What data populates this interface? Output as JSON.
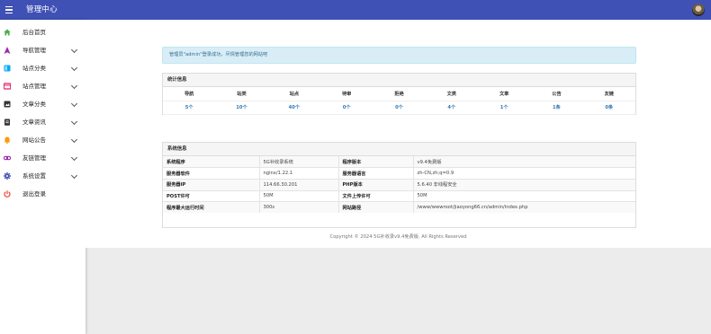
{
  "header": {
    "title": "管理中心",
    "menu_icon": "hamburger-menu-icon",
    "avatar_icon": "user-avatar-icon"
  },
  "sidebar": {
    "items": [
      {
        "label": "后台首页",
        "icon": "home-icon",
        "color": "#4caf50",
        "has_submenu": false
      },
      {
        "label": "导航管理",
        "icon": "navigation-icon",
        "color": "#9c27b0",
        "has_submenu": true
      },
      {
        "label": "站点分类",
        "icon": "category-icon",
        "color": "#03a9f4",
        "has_submenu": true
      },
      {
        "label": "站点管理",
        "icon": "site-manage-icon",
        "color": "#e91e63",
        "has_submenu": true
      },
      {
        "label": "文章分类",
        "icon": "article-category-icon",
        "color": "#333333",
        "has_submenu": true
      },
      {
        "label": "文章资讯",
        "icon": "article-news-icon",
        "color": "#333333",
        "has_submenu": true
      },
      {
        "label": "网站公告",
        "icon": "bell-icon",
        "color": "#ff9800",
        "has_submenu": true
      },
      {
        "label": "友链管理",
        "icon": "link-icon",
        "color": "#9c27b0",
        "has_submenu": true
      },
      {
        "label": "系统设置",
        "icon": "gear-icon",
        "color": "#3f51b5",
        "has_submenu": true
      },
      {
        "label": "退出登录",
        "icon": "power-icon",
        "color": "#f44336",
        "has_submenu": false
      }
    ]
  },
  "alert": {
    "text": "管理员\"admin\"登录成功，尽情管理您的网站吧"
  },
  "stats": {
    "title": "统计信息",
    "headers": [
      "导航",
      "站类",
      "站点",
      "待审",
      "拒绝",
      "文类",
      "文章",
      "公告",
      "友链"
    ],
    "values": [
      "5个",
      "10个",
      "40个",
      "0个",
      "0个",
      "4个",
      "1个",
      "1条",
      "0条"
    ]
  },
  "system": {
    "title": "系统信息",
    "rows": [
      {
        "k1": "系统程序",
        "v1": "5G补收录系统",
        "k2": "程序版本",
        "v2": "v9.4免费版"
      },
      {
        "k1": "服务器软件",
        "v1": "nginx/1.22.1",
        "k2": "服务器语言",
        "v2": "zh-CN,zh;q=0.9"
      },
      {
        "k1": "服务器IP",
        "v1": "114.66.30.201",
        "k2": "PHP版本",
        "v2": "5.6.40 非线程安全"
      },
      {
        "k1": "POST许可",
        "v1": "50M",
        "k2": "文件上传许可",
        "v2": "50M"
      },
      {
        "k1": "程序最大运行时间",
        "v1": "300s",
        "k2": "网站路径",
        "v2": "/www/wwwroot/jiaoyong66.cn/admin/index.php"
      }
    ]
  },
  "footer": {
    "text": "Copyright © 2024 5G补收录v9.4免费版. All Rights Reserved"
  }
}
